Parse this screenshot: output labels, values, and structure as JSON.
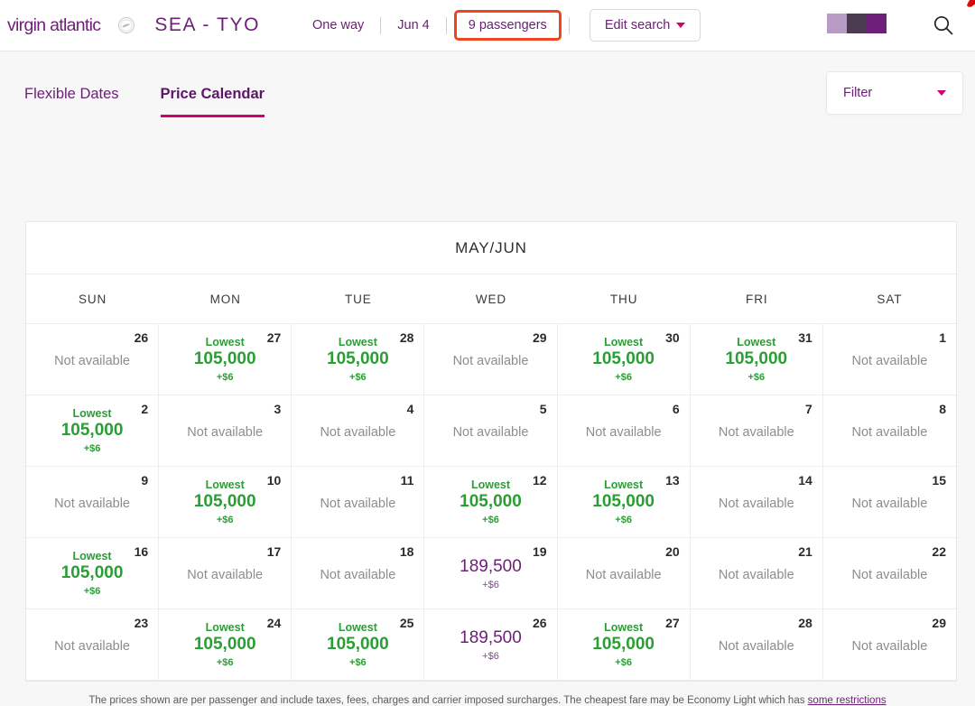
{
  "header": {
    "logo_text": "virgin atlantic",
    "logo_icon": "virgin-swoosh-icon",
    "emblem_icon": "flying-lady-emblem-icon",
    "route": "SEA - TYO",
    "trip_type": "One way",
    "date": "Jun 4",
    "passengers": "9 passengers",
    "edit_search": "Edit search",
    "search_icon": "search-icon",
    "highlight_color": "#f0441e",
    "brand_purple": "#6d2077",
    "brand_magenta": "#d0006f"
  },
  "tabs": [
    {
      "label": "Flexible Dates",
      "active": false
    },
    {
      "label": "Price Calendar",
      "active": true
    }
  ],
  "filter": {
    "label": "Filter",
    "icon": "chevron-down-icon"
  },
  "calendar": {
    "title": "MAY/JUN",
    "dow": [
      "SUN",
      "MON",
      "TUE",
      "WED",
      "THU",
      "FRI",
      "SAT"
    ],
    "unavailable_label": "Not available",
    "lowest_label": "Lowest",
    "green": "#2a9e34",
    "purple": "#6d2077",
    "cells": [
      {
        "day": "26",
        "state": "unavailable"
      },
      {
        "day": "27",
        "state": "lowest",
        "price": "105,000",
        "tax": "+$6"
      },
      {
        "day": "28",
        "state": "lowest",
        "price": "105,000",
        "tax": "+$6"
      },
      {
        "day": "29",
        "state": "unavailable"
      },
      {
        "day": "30",
        "state": "lowest",
        "price": "105,000",
        "tax": "+$6"
      },
      {
        "day": "31",
        "state": "lowest",
        "price": "105,000",
        "tax": "+$6"
      },
      {
        "day": "1",
        "state": "unavailable"
      },
      {
        "day": "2",
        "state": "lowest",
        "price": "105,000",
        "tax": "+$6"
      },
      {
        "day": "3",
        "state": "unavailable"
      },
      {
        "day": "4",
        "state": "unavailable"
      },
      {
        "day": "5",
        "state": "unavailable"
      },
      {
        "day": "6",
        "state": "unavailable"
      },
      {
        "day": "7",
        "state": "unavailable"
      },
      {
        "day": "8",
        "state": "unavailable"
      },
      {
        "day": "9",
        "state": "unavailable"
      },
      {
        "day": "10",
        "state": "lowest",
        "price": "105,000",
        "tax": "+$6"
      },
      {
        "day": "11",
        "state": "unavailable"
      },
      {
        "day": "12",
        "state": "lowest",
        "price": "105,000",
        "tax": "+$6"
      },
      {
        "day": "13",
        "state": "lowest",
        "price": "105,000",
        "tax": "+$6"
      },
      {
        "day": "14",
        "state": "unavailable"
      },
      {
        "day": "15",
        "state": "unavailable"
      },
      {
        "day": "16",
        "state": "lowest",
        "price": "105,000",
        "tax": "+$6"
      },
      {
        "day": "17",
        "state": "unavailable"
      },
      {
        "day": "18",
        "state": "unavailable"
      },
      {
        "day": "19",
        "state": "priced",
        "price": "189,500",
        "tax": "+$6"
      },
      {
        "day": "20",
        "state": "unavailable"
      },
      {
        "day": "21",
        "state": "unavailable"
      },
      {
        "day": "22",
        "state": "unavailable"
      },
      {
        "day": "23",
        "state": "unavailable"
      },
      {
        "day": "24",
        "state": "lowest",
        "price": "105,000",
        "tax": "+$6"
      },
      {
        "day": "25",
        "state": "lowest",
        "price": "105,000",
        "tax": "+$6"
      },
      {
        "day": "26",
        "state": "priced",
        "price": "189,500",
        "tax": "+$6"
      },
      {
        "day": "27",
        "state": "lowest",
        "price": "105,000",
        "tax": "+$6"
      },
      {
        "day": "28",
        "state": "unavailable"
      },
      {
        "day": "29",
        "state": "unavailable"
      }
    ]
  },
  "footer": {
    "text": "The prices shown are per passenger and include taxes, fees, charges and carrier imposed surcharges. The cheapest fare may be Economy Light which has ",
    "link": "some restrictions"
  }
}
